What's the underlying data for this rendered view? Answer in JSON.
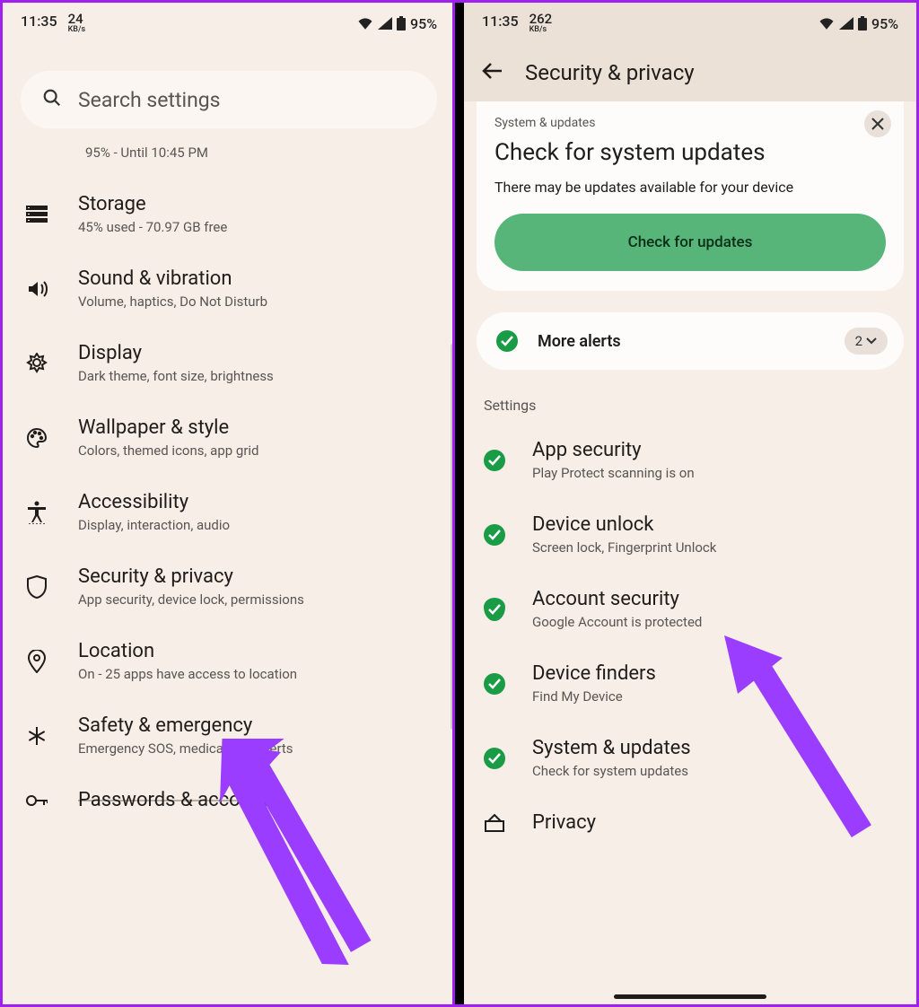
{
  "status_bar_left": {
    "time": "11:35",
    "speed_num": "24",
    "speed_unit": "KB/s"
  },
  "status_bar_right_battery": "95%",
  "status_bar_left2": {
    "time": "11:35",
    "speed_num": "262",
    "speed_unit": "KB/s"
  },
  "status_bar_right_battery2": "95%",
  "search_placeholder": "Search settings",
  "partial_subtitle": "95% - Until 10:45 PM",
  "settings_items": {
    "storage": {
      "title": "Storage",
      "sub": "45% used - 70.97 GB free"
    },
    "sound": {
      "title": "Sound & vibration",
      "sub": "Volume, haptics, Do Not Disturb"
    },
    "display": {
      "title": "Display",
      "sub": "Dark theme, font size, brightness"
    },
    "wallpaper": {
      "title": "Wallpaper & style",
      "sub": "Colors, themed icons, app grid"
    },
    "a11y": {
      "title": "Accessibility",
      "sub": "Display, interaction, audio"
    },
    "security": {
      "title": "Security & privacy",
      "sub": "App security, device lock, permissions"
    },
    "location": {
      "title": "Location",
      "sub": "On - 25 apps have access to location"
    },
    "safety": {
      "title": "Safety & emergency",
      "sub": "Emergency SOS, medical info, alerts"
    },
    "passwords": {
      "title": "Passwords & accounts"
    }
  },
  "header_title": "Security & privacy",
  "update_card": {
    "eyebrow": "System & updates",
    "headline": "Check for system updates",
    "body": "There may be updates available for your device",
    "cta": "Check for updates"
  },
  "more_alerts": {
    "label": "More alerts",
    "count": "2"
  },
  "section_label": "Settings",
  "sec_items": {
    "app_security": {
      "title": "App security",
      "sub": "Play Protect scanning is on"
    },
    "device_unlock": {
      "title": "Device unlock",
      "sub": "Screen lock, Fingerprint Unlock"
    },
    "account_security": {
      "title": "Account security",
      "sub": "Google Account is protected"
    },
    "device_finders": {
      "title": "Device finders",
      "sub": "Find My Device"
    },
    "system_updates": {
      "title": "System & updates",
      "sub": "Check for system updates"
    },
    "privacy": {
      "title": "Privacy"
    }
  }
}
